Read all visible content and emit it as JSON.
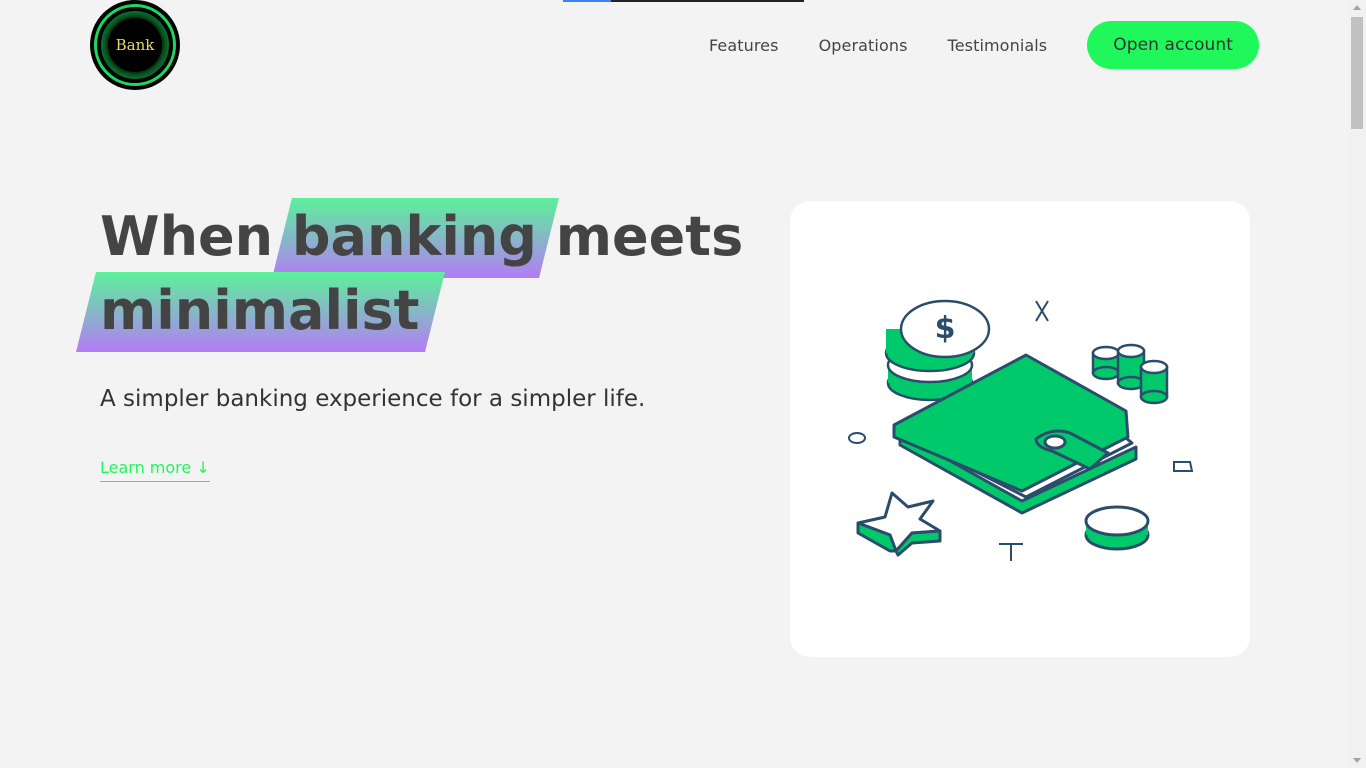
{
  "header": {
    "logo_text": "Bank",
    "nav": [
      {
        "label": "Features"
      },
      {
        "label": "Operations"
      },
      {
        "label": "Testimonials"
      }
    ],
    "cta_label": "Open account"
  },
  "hero": {
    "title_part1": "When",
    "title_highlight1": "banking",
    "title_part2": "meets",
    "title_highlight2": "minimalist",
    "subtitle": "A simpler banking experience for a simpler life.",
    "learn_more": "Learn more ↓"
  },
  "colors": {
    "accent": "#1ff75b",
    "highlight_top": "#5cf19a",
    "highlight_bottom": "#b37cf5",
    "illustration_green": "#00c96b",
    "illustration_stroke": "#2b4d6b"
  },
  "illustration": {
    "icons": [
      "wallet-icon",
      "dollar-coin-icon",
      "coin-stack-icon",
      "star-icon",
      "sparkle-icon"
    ]
  }
}
